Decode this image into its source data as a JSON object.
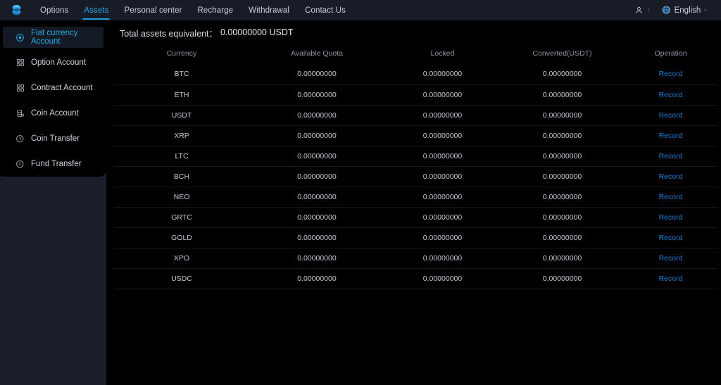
{
  "brand": {
    "logo_icon": "stacked-layers-logo",
    "accent": "#1c9ad6"
  },
  "topnav": {
    "items": [
      {
        "label": "Options",
        "active": false
      },
      {
        "label": "Assets",
        "active": true
      },
      {
        "label": "Personal center",
        "active": false
      },
      {
        "label": "Recharge",
        "active": false
      },
      {
        "label": "Withdrawal",
        "active": false
      },
      {
        "label": "Contact Us",
        "active": false
      }
    ],
    "account": {
      "icon": "user-icon",
      "chevron": "‹"
    },
    "language": {
      "icon": "globe-icon",
      "label": "English",
      "chevron": "‹"
    }
  },
  "sidebar": {
    "items": [
      {
        "label": "Fiat currency Account",
        "icon": "target-circle-icon",
        "active": true
      },
      {
        "label": "Option Account",
        "icon": "option-grid-icon",
        "active": false
      },
      {
        "label": "Contract Account",
        "icon": "contract-grid-icon",
        "active": false
      },
      {
        "label": "Coin Account",
        "icon": "database-icon",
        "active": false
      },
      {
        "label": "Coin Transfer",
        "icon": "transfer-circle-icon",
        "active": false
      },
      {
        "label": "Fund Transfer",
        "icon": "fund-circle-icon",
        "active": false
      }
    ]
  },
  "main": {
    "total_label": "Total assets equivalent：",
    "total_value": "0.00000000 USDT",
    "table": {
      "columns": [
        "Currency",
        "Available Quota",
        "Locked",
        "Converted(USDT)",
        "Operation"
      ],
      "action_label": "Record",
      "rows": [
        {
          "currency": "BTC",
          "available": "0.00000000",
          "locked": "0.00000000",
          "converted": "0.00000000",
          "action": "Record"
        },
        {
          "currency": "ETH",
          "available": "0.00000000",
          "locked": "0.00000000",
          "converted": "0.00000000",
          "action": "Record"
        },
        {
          "currency": "USDT",
          "available": "0.00000000",
          "locked": "0.00000000",
          "converted": "0.00000000",
          "action": "Record"
        },
        {
          "currency": "XRP",
          "available": "0.00000000",
          "locked": "0.00000000",
          "converted": "0.00000000",
          "action": "Record"
        },
        {
          "currency": "LTC",
          "available": "0.00000000",
          "locked": "0.00000000",
          "converted": "0.00000000",
          "action": "Record"
        },
        {
          "currency": "BCH",
          "available": "0.00000000",
          "locked": "0.00000000",
          "converted": "0.00000000",
          "action": "Record"
        },
        {
          "currency": "NEO",
          "available": "0.00000000",
          "locked": "0.00000000",
          "converted": "0.00000000",
          "action": "Record"
        },
        {
          "currency": "GRTC",
          "available": "0.00000000",
          "locked": "0.00000000",
          "converted": "0.00000000",
          "action": "Record"
        },
        {
          "currency": "GOLD",
          "available": "0.00000000",
          "locked": "0.00000000",
          "converted": "0.00000000",
          "action": "Record"
        },
        {
          "currency": "XPO",
          "available": "0.00000000",
          "locked": "0.00000000",
          "converted": "0.00000000",
          "action": "Record"
        },
        {
          "currency": "USDC",
          "available": "0.00000000",
          "locked": "0.00000000",
          "converted": "0.00000000",
          "action": "Record"
        }
      ]
    }
  }
}
